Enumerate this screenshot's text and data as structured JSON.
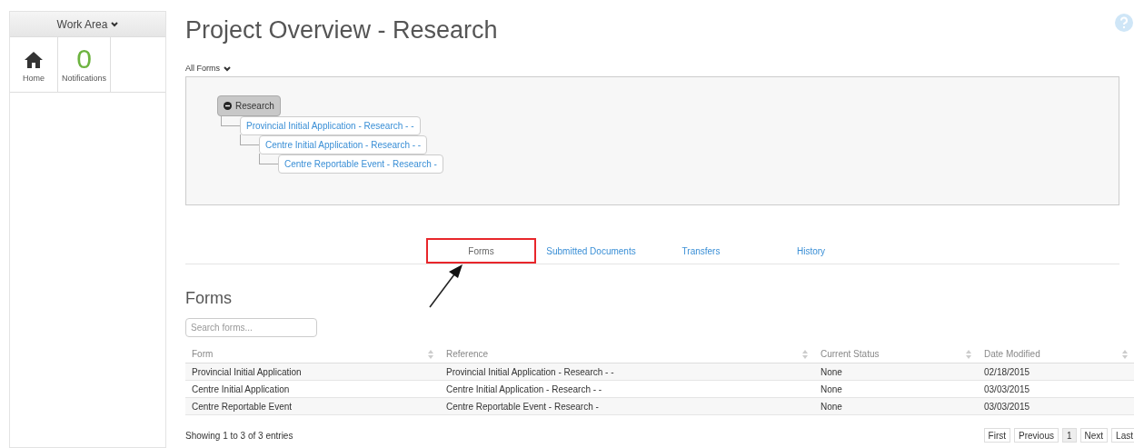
{
  "sidebar": {
    "header": "Work Area",
    "tiles": [
      {
        "kind": "icon",
        "label": "Home"
      },
      {
        "kind": "count",
        "value": "0",
        "label": "Notifications"
      }
    ]
  },
  "title": "Project Overview - Research",
  "filter": {
    "label": "All Forms"
  },
  "tree": [
    {
      "label": "Research",
      "kind": "root",
      "expanded": true,
      "children": [
        {
          "label": "Provincial Initial Application - Research - -",
          "kind": "link",
          "children": [
            {
              "label": "Centre Initial Application - Research - -",
              "kind": "link",
              "children": [
                {
                  "label": "Centre Reportable Event - Research -",
                  "kind": "link"
                }
              ]
            }
          ]
        }
      ]
    }
  ],
  "tabs": [
    {
      "label": "Forms",
      "selected": true
    },
    {
      "label": "Submitted Documents",
      "selected": false
    },
    {
      "label": "Transfers",
      "selected": false
    },
    {
      "label": "History",
      "selected": false
    }
  ],
  "section_title": "Forms",
  "search": {
    "placeholder": "Search forms..."
  },
  "table": {
    "columns": [
      "Form",
      "Reference",
      "Current Status",
      "Date Modified"
    ],
    "rows": [
      [
        "Provincial Initial Application",
        "Provincial Initial Application - Research - -",
        "None",
        "02/18/2015"
      ],
      [
        "Centre Initial Application",
        "Centre Initial Application - Research - -",
        "None",
        "03/03/2015"
      ],
      [
        "Centre Reportable Event",
        "Centre Reportable Event - Research -",
        "None",
        "03/03/2015"
      ]
    ]
  },
  "footer": {
    "info": "Showing 1 to 3 of 3 entries",
    "pages": [
      {
        "label": "First",
        "selected": false
      },
      {
        "label": "Previous",
        "selected": false
      },
      {
        "label": "1",
        "selected": true
      },
      {
        "label": "Next",
        "selected": false
      },
      {
        "label": "Last",
        "selected": false
      }
    ]
  }
}
